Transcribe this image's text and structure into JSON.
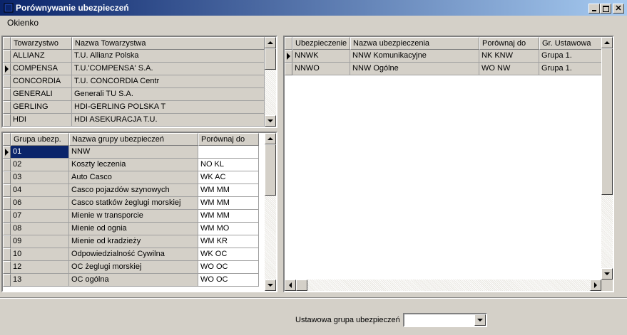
{
  "window": {
    "title": "Porównywanie ubezpieczeń"
  },
  "menu": {
    "items": [
      "Okienko"
    ]
  },
  "companies": {
    "headers": [
      "Towarzystwo",
      "Nazwa Towarzystwa"
    ],
    "rows": [
      [
        "ALLIANZ",
        "T.U. Allianz Polska"
      ],
      [
        "COMPENSA",
        "T.U.'COMPENSA' S.A."
      ],
      [
        "CONCORDIA",
        "T.U. CONCORDIA Centr"
      ],
      [
        "GENERALI",
        "Generali TU S.A."
      ],
      [
        "GERLING",
        "HDI-GERLING POLSKA T"
      ],
      [
        "HDI",
        "HDI ASEKURACJA T.U."
      ]
    ],
    "current_row": 1
  },
  "groups": {
    "headers": [
      "Grupa ubezp.",
      "Nazwa grupy ubezpieczeń",
      "Porównaj do"
    ],
    "rows": [
      [
        "01",
        "NNW",
        ""
      ],
      [
        "02",
        "Koszty leczenia",
        "NO KL"
      ],
      [
        "03",
        "Auto Casco",
        "WK AC"
      ],
      [
        "04",
        "Casco pojazdów szynowych",
        "WM MM"
      ],
      [
        "06",
        "Casco statków żeglugi morskiej",
        "WM MM"
      ],
      [
        "07",
        "Mienie w transporcie",
        "WM MM"
      ],
      [
        "08",
        "Mienie od ognia",
        "WM MO"
      ],
      [
        "09",
        "Mienie od kradzieży",
        "WM KR"
      ],
      [
        "10",
        "Odpowiedzialność Cywilna",
        "WK OC"
      ],
      [
        "12",
        "OC żeglugi morskiej",
        "WO OC"
      ],
      [
        "13",
        "OC ogólna",
        "WO OC"
      ]
    ],
    "current_row": 0
  },
  "insurances": {
    "headers": [
      "Ubezpieczenie",
      "Nazwa ubezpieczenia",
      "Porównaj do",
      "Gr. Ustawowa"
    ],
    "rows": [
      [
        "NNWK",
        "NNW Komunikacyjne",
        "NK KNW",
        "Grupa 1."
      ],
      [
        "NNWO",
        "NNW Ogólne",
        "WO NW",
        "Grupa 1."
      ]
    ],
    "current_row": 0
  },
  "statutory_group": {
    "label": "Ustawowa grupa ubezpieczeń",
    "value": ""
  },
  "icons": {
    "app": "app-icon",
    "minimize": "minimize-icon",
    "maximize": "maximize-icon",
    "close": "close-icon"
  },
  "colors": {
    "title_start": "#0a246a",
    "title_end": "#a6caf0",
    "face": "#d4d0c8",
    "selection": "#0a246a"
  }
}
